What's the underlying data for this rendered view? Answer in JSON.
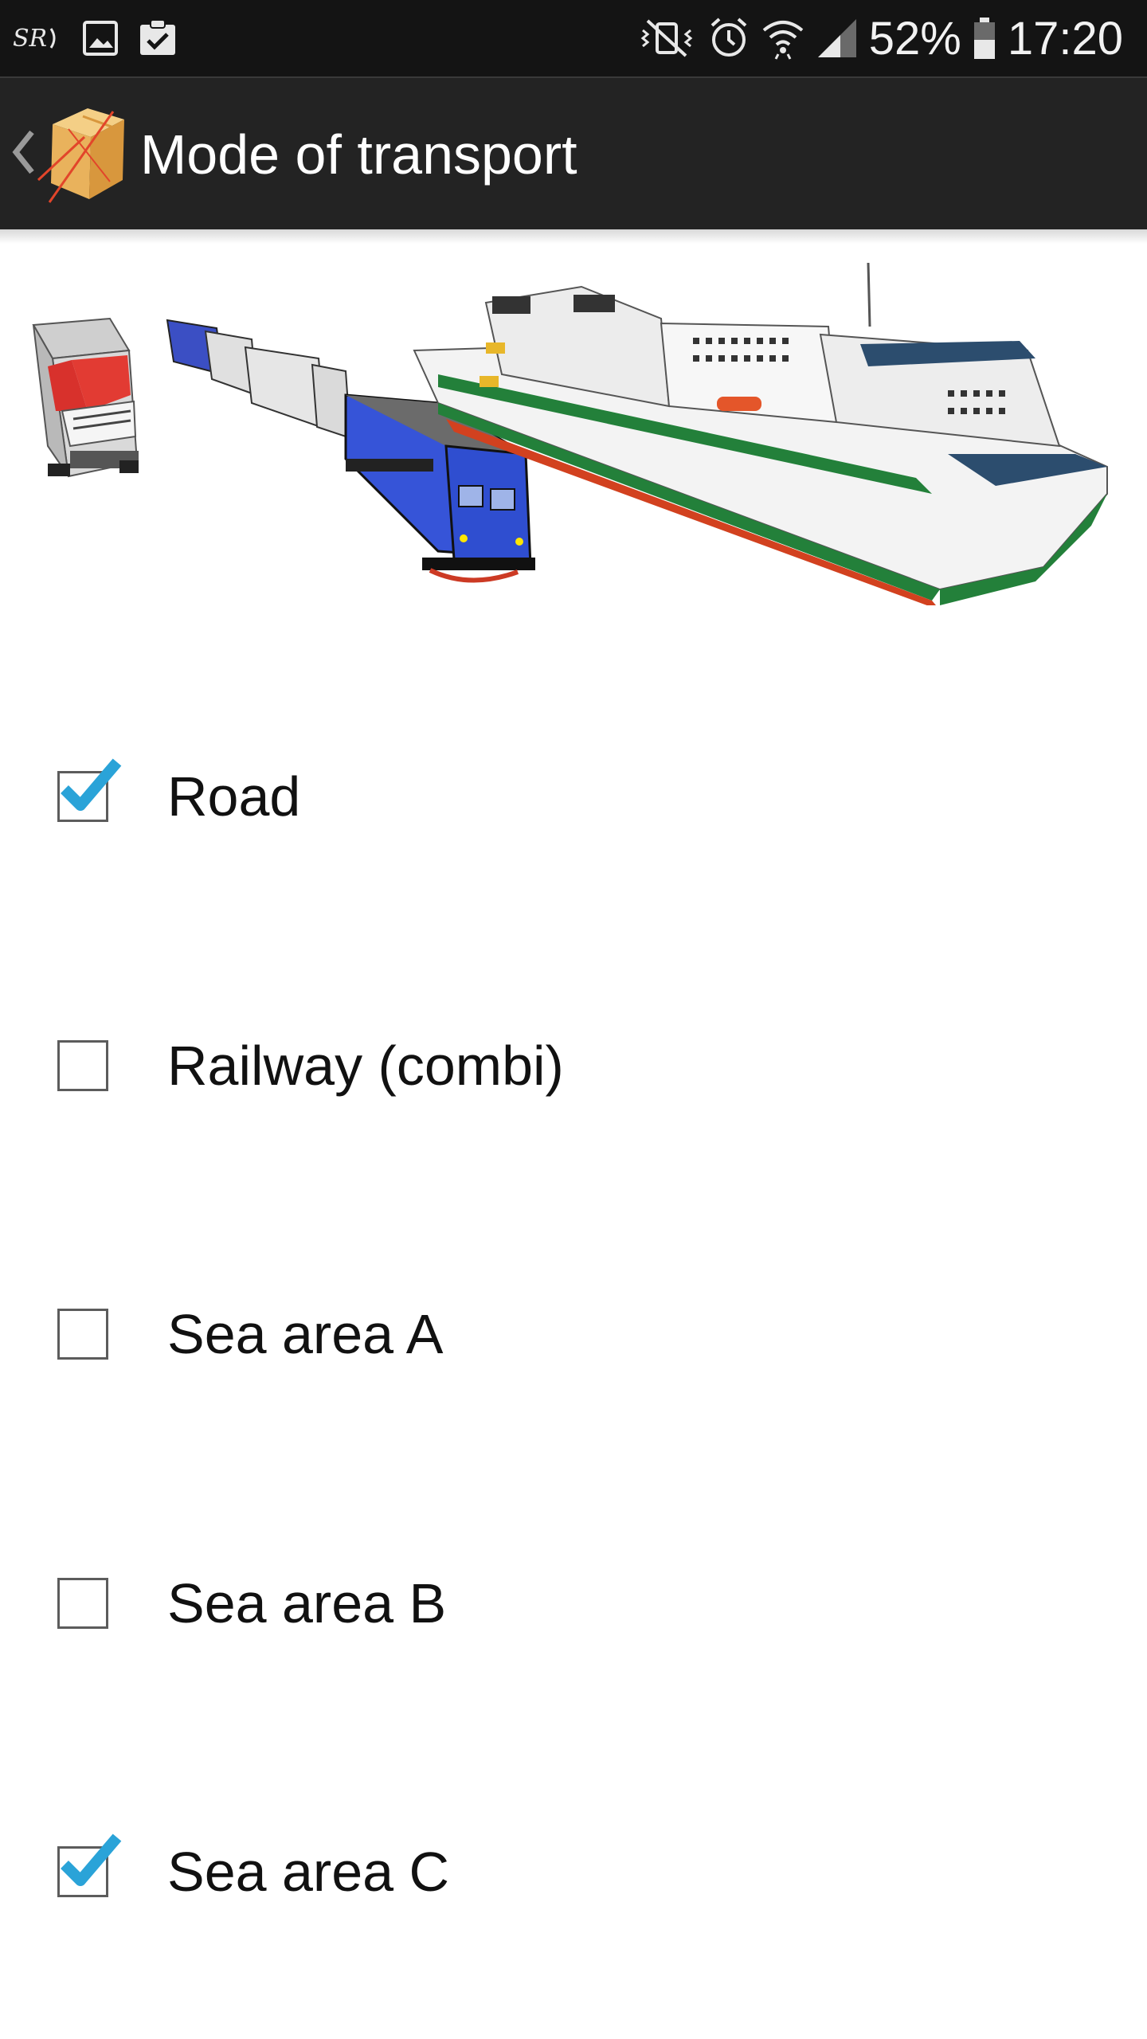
{
  "status_bar": {
    "carrier_icon": "carrier-logo-icon",
    "battery_percent": "52%",
    "time": "17:20",
    "icons": [
      "image-notification-icon",
      "clipboard-check-icon",
      "vibrate-mute-icon",
      "alarm-icon",
      "wifi-icon",
      "signal-icon",
      "battery-icon"
    ]
  },
  "action_bar": {
    "title": "Mode of transport",
    "logo_icon": "package-box-icon",
    "up_icon": "chevron-left-icon"
  },
  "hero": {
    "image_name": "transport-vehicles-illustration"
  },
  "options": [
    {
      "label": "Road",
      "checked": true
    },
    {
      "label": "Railway (combi)",
      "checked": false
    },
    {
      "label": "Sea area A",
      "checked": false
    },
    {
      "label": "Sea area B",
      "checked": false
    },
    {
      "label": "Sea area C",
      "checked": true
    }
  ],
  "colors": {
    "status_bar": "#141414",
    "action_bar": "#232323",
    "check_accent": "#2aa3d8"
  }
}
